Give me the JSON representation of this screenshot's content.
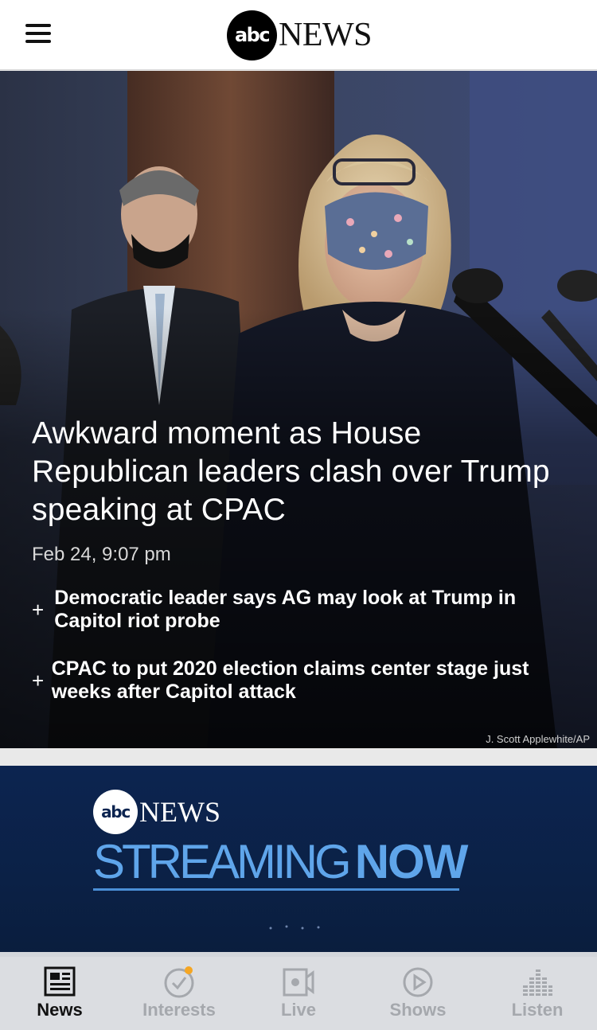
{
  "header": {
    "logo_abc": "abc",
    "logo_news": "NEWS"
  },
  "hero": {
    "headline": "Awkward moment as House Republican leaders clash over Trump speaking at CPAC",
    "date": "Feb 24, 9:07 pm",
    "photo_credit": "J. Scott Applewhite/AP",
    "related": [
      {
        "icon": "plus-icon",
        "label": "Democratic leader says AG may look at Trump in Capitol riot probe"
      },
      {
        "icon": "plus-icon",
        "label": "CPAC to put 2020 election claims center stage just weeks after Capitol attack"
      }
    ]
  },
  "stream_banner": {
    "logo_abc": "abc",
    "logo_news": "NEWS",
    "streaming": "STREAMING",
    "now": "NOW"
  },
  "tabbar": {
    "tabs": [
      {
        "label": "News",
        "icon": "newspaper-icon",
        "active": true
      },
      {
        "label": "Interests",
        "icon": "check-circle-icon",
        "active": false,
        "badge": true
      },
      {
        "label": "Live",
        "icon": "video-camera-icon",
        "active": false
      },
      {
        "label": "Shows",
        "icon": "play-circle-icon",
        "active": false
      },
      {
        "label": "Listen",
        "icon": "equalizer-icon",
        "active": false
      }
    ]
  },
  "colors": {
    "active_tab": "#111111",
    "inactive_tab": "#a5a8ad",
    "badge": "#f5a623",
    "stream_bg": "#0c2450",
    "stream_text": "#5fa5ea"
  }
}
